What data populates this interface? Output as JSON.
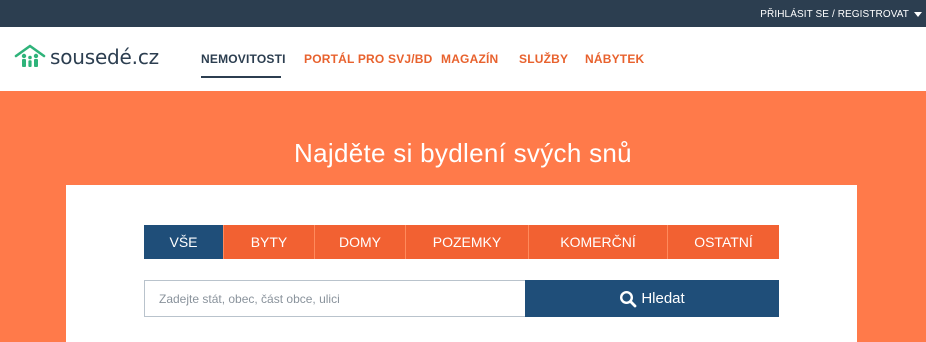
{
  "header": {
    "login_label": "PŘIHLÁSIT SE / REGISTROVAT",
    "login_caret_icon": "caret-down-icon"
  },
  "logo": {
    "icon": "house-family-icon",
    "text": "sousedé.cz",
    "icon_color": "#2fb37a"
  },
  "nav": {
    "items": [
      {
        "label": "NEMOVITOSTI",
        "active": true
      },
      {
        "label": "PORTÁL PRO SVJ/BD",
        "active": false
      },
      {
        "label": "MAGAZÍN",
        "active": false
      },
      {
        "label": "SLUŽBY",
        "active": false
      },
      {
        "label": "NÁBYTEK",
        "active": false
      }
    ]
  },
  "hero": {
    "title": "Najděte si bydlení svých snů",
    "background_color": "#ff7a4a"
  },
  "search": {
    "tabs": [
      {
        "label": "VŠE",
        "active": true
      },
      {
        "label": "BYTY",
        "active": false
      },
      {
        "label": "DOMY",
        "active": false
      },
      {
        "label": "POZEMKY",
        "active": false
      },
      {
        "label": "KOMERČNÍ",
        "active": false
      },
      {
        "label": "OSTATNÍ",
        "active": false
      }
    ],
    "placeholder": "Zadejte stát, obec, část obce, ulici",
    "value": "",
    "button_label": "Hledat",
    "button_icon": "search-icon"
  },
  "colors": {
    "navy": "#2c3e50",
    "accent_orange": "#e8622e",
    "tab_orange": "#f26132",
    "button_blue": "#1f4e79"
  }
}
